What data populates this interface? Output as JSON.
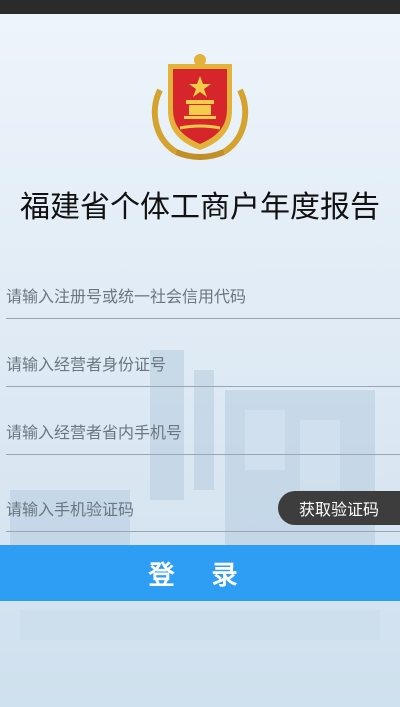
{
  "title": "福建省个体工商户年度报告",
  "form": {
    "registration_placeholder": "请输入注册号或统一社会信用代码",
    "id_placeholder": "请输入经营者身份证号",
    "phone_placeholder": "请输入经营者省内手机号",
    "sms_placeholder": "请输入手机验证码",
    "get_code_label": "获取验证码"
  },
  "login_label": "登 录",
  "colors": {
    "login_button": "#2e9ef5",
    "code_button": "#3d3d3d",
    "status_bar": "#2b2b2b",
    "emblem_red": "#d6262b",
    "emblem_gold": "#e2b23a"
  },
  "icons": {
    "emblem": "aic-emblem-icon"
  }
}
